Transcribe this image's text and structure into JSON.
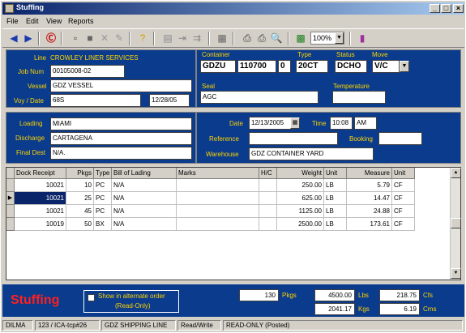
{
  "window": {
    "title": "Stuffing"
  },
  "menu": [
    "File",
    "Edit",
    "View",
    "Reports"
  ],
  "toolbar": {
    "zoom": "100%"
  },
  "header": {
    "line_label": "Line",
    "line_value": "CROWLEY LINER SERVICES",
    "job_num_label": "Job Num",
    "job_num": "00105008-02",
    "vessel_label": "Vessel",
    "vessel": "GDZ VESSEL",
    "voy_date_label": "Voy / Date",
    "voy": "68S",
    "date": "12/28/05",
    "container_label": "Container",
    "container_prefix": "GDZU",
    "container_number": "110700",
    "container_check": "0",
    "type_label": "Type",
    "type": "20CT",
    "status_label": "Status",
    "status": "DCHO",
    "move_label": "Move",
    "move": "V/C",
    "seal_label": "Seal",
    "seal": "AGC",
    "temperature_label": "Temperature",
    "temperature": ""
  },
  "routing": {
    "loading_label": "Loading",
    "loading": "MIAMI",
    "discharge_label": "Discharge",
    "discharge": "CARTAGENA",
    "final_dest_label": "Final Dest",
    "final_dest": "N/A.",
    "date_label": "Date",
    "date": "12/13/2005",
    "time_label": "Time",
    "time": "10:08",
    "ampm": "AM",
    "reference_label": "Reference",
    "reference": "",
    "booking_label": "Booking",
    "booking": "",
    "warehouse_label": "Warehouse",
    "warehouse": "GDZ CONTAINER YARD"
  },
  "grid": {
    "columns": [
      "Dock Receipt",
      "Pkgs",
      "Type",
      "Bill of Lading",
      "Marks",
      "H/C",
      "Weight",
      "Unit",
      "Measure",
      "Unit"
    ],
    "rows": [
      [
        "10021",
        "10",
        "PC",
        "N/A",
        "",
        "",
        "250.00",
        "LB",
        "5.79",
        "CF"
      ],
      [
        "10021",
        "25",
        "PC",
        "N/A",
        "",
        "",
        "625.00",
        "LB",
        "14.47",
        "CF"
      ],
      [
        "10021",
        "45",
        "PC",
        "N/A",
        "",
        "",
        "1125.00",
        "LB",
        "24.88",
        "CF"
      ],
      [
        "10019",
        "50",
        "BX",
        "N/A",
        "",
        "",
        "2500.00",
        "LB",
        "173.61",
        "CF"
      ]
    ],
    "selected_row": 1
  },
  "footer": {
    "screen_title": "Stuffing",
    "alt_order_label": "Show in alternate order",
    "alt_order_sub": "(Read-Only)",
    "pkgs_total": "130",
    "pkgs_label": "Pkgs",
    "lbs_total": "4500.00",
    "lbs_label": "Lbs",
    "cfs_total": "218.75",
    "cfs_label": "Cfs",
    "kgs_total": "2041.17",
    "kgs_label": "Kgs",
    "cms_total": "6.19",
    "cms_label": "Cms"
  },
  "statusbar": [
    "DILMA",
    "123 / ICA-tcp#26",
    "GDZ SHIPPING LINE",
    "Read/Write",
    "READ-ONLY (Posted)"
  ],
  "colors": {
    "panel": "#0a3b8c",
    "label": "#ffd400",
    "title_red": "#ff2020"
  }
}
